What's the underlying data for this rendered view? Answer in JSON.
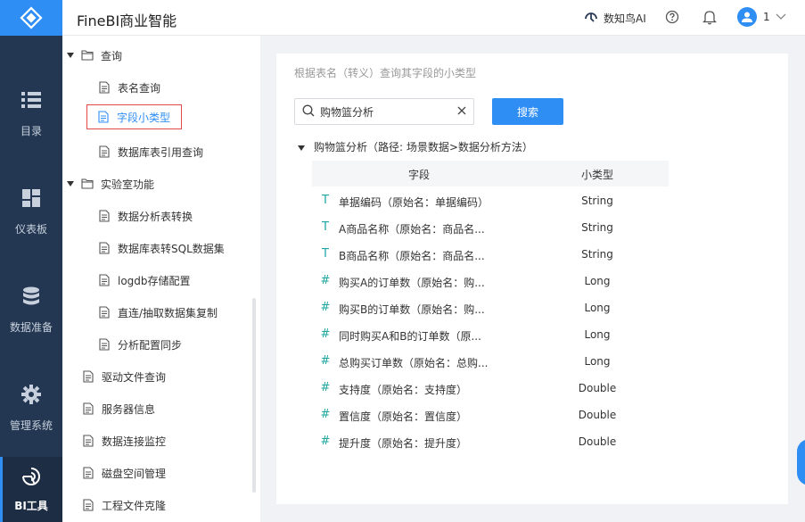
{
  "header": {
    "title": "FineBI商业智能",
    "ai_label": "数知鸟AI",
    "user_name": "1"
  },
  "rail": {
    "items": [
      {
        "label": "目录",
        "icon": "list-icon"
      },
      {
        "label": "仪表板",
        "icon": "dashboard-icon"
      },
      {
        "label": "数据准备",
        "icon": "database-icon"
      },
      {
        "label": "管理系统",
        "icon": "gear-icon"
      },
      {
        "label": "BI工具",
        "icon": "bi-tool-icon"
      }
    ]
  },
  "tree": {
    "items": [
      {
        "label": "查询",
        "level": 0,
        "type": "folder",
        "expanded": true
      },
      {
        "label": "表名查询",
        "level": 1,
        "type": "file"
      },
      {
        "label": "字段小类型",
        "level": 1,
        "type": "file",
        "selected": true
      },
      {
        "label": "数据库表引用查询",
        "level": 1,
        "type": "file"
      },
      {
        "label": "实验室功能",
        "level": 0,
        "type": "folder",
        "expanded": true
      },
      {
        "label": "数据分析表转换",
        "level": 1,
        "type": "file"
      },
      {
        "label": "数据库表转SQL数据集",
        "level": 1,
        "type": "file"
      },
      {
        "label": "logdb存储配置",
        "level": 1,
        "type": "file"
      },
      {
        "label": "直连/抽取数据集复制",
        "level": 1,
        "type": "file"
      },
      {
        "label": "分析配置同步",
        "level": 1,
        "type": "file"
      },
      {
        "label": "驱动文件查询",
        "level": 0,
        "type": "file"
      },
      {
        "label": "服务器信息",
        "level": 0,
        "type": "file"
      },
      {
        "label": "数据连接监控",
        "level": 0,
        "type": "file"
      },
      {
        "label": "磁盘空间管理",
        "level": 0,
        "type": "file"
      },
      {
        "label": "工程文件克隆",
        "level": 0,
        "type": "file"
      }
    ]
  },
  "main": {
    "description": "根据表名（转义）查询其字段的小类型",
    "search_value": "购物篮分析",
    "search_button": "搜索",
    "result_title": "购物篮分析（路径: 场景数据>数据分析方法）",
    "columns": [
      "字段",
      "小类型"
    ],
    "rows": [
      {
        "icon": "T",
        "field": "单据编码（原始名：单据编码）",
        "type": "String"
      },
      {
        "icon": "T",
        "field": "A商品名称（原始名：商品名...",
        "type": "String"
      },
      {
        "icon": "T",
        "field": "B商品名称（原始名：商品名...",
        "type": "String"
      },
      {
        "icon": "#",
        "field": "购买A的订单数（原始名：购...",
        "type": "Long"
      },
      {
        "icon": "#",
        "field": "购买B的订单数（原始名：购...",
        "type": "Long"
      },
      {
        "icon": "#",
        "field": "同时购买A和B的订单数（原...",
        "type": "Long"
      },
      {
        "icon": "#",
        "field": "总购买订单数（原始名：总购...",
        "type": "Long"
      },
      {
        "icon": "#",
        "field": "支持度（原始名：支持度）",
        "type": "Double"
      },
      {
        "icon": "#",
        "field": "置信度（原始名：置信度）",
        "type": "Double"
      },
      {
        "icon": "#",
        "field": "提升度（原始名：提升度）",
        "type": "Double"
      }
    ]
  },
  "colors": {
    "rail_bg": "#233752",
    "accent": "#2f8ef4",
    "selected_border": "#e14a4a",
    "field_icon": "#1ea7a0"
  }
}
